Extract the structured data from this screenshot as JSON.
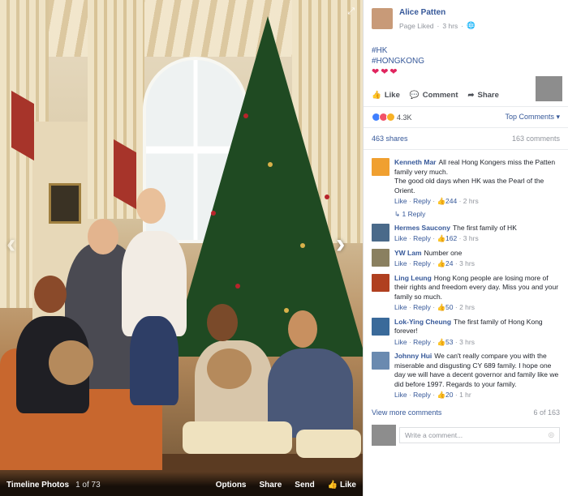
{
  "photo_viewer": {
    "album_label": "Timeline Photos",
    "photo_counter": "1 of 73",
    "actions": {
      "options": "Options",
      "share": "Share",
      "send": "Send",
      "like": "Like"
    }
  },
  "post": {
    "author": "Alice Patten",
    "meta_status": "Page Liked",
    "meta_time": "3 hrs",
    "hashtags": [
      "#HK",
      "#HONGKONG"
    ],
    "hearts": "❤❤❤",
    "actions": {
      "like": "Like",
      "comment": "Comment",
      "share": "Share"
    },
    "reaction_count": "4.3K",
    "top_comments": "Top Comments ▾",
    "shares": "463 shares",
    "comment_count": "163 comments"
  },
  "comments": [
    {
      "name": "Kenneth Mar",
      "text": "All real Hong Kongers miss the Patten family very much.\nThe good old days when HK was the Pearl of the Orient.",
      "likes": "244",
      "time": "2 hrs",
      "avatar_color": "#f0a030",
      "reply": "1 Reply"
    },
    {
      "name": "Hermes Saucony",
      "text": "The first family of HK",
      "likes": "162",
      "time": "3 hrs",
      "avatar_color": "#4a6a8a"
    },
    {
      "name": "YW Lam",
      "text": "Number one",
      "likes": "24",
      "time": "3 hrs",
      "avatar_color": "#8a8060"
    },
    {
      "name": "Ling Leung",
      "text": "Hong Kong people are losing more of their rights and freedom every day. Miss you and your family so much.",
      "likes": "50",
      "time": "2 hrs",
      "avatar_color": "#b04020"
    },
    {
      "name": "Lok-Ying Cheung",
      "text": "The first family of Hong Kong forever!",
      "likes": "53",
      "time": "3 hrs",
      "avatar_color": "#3a6a9a"
    },
    {
      "name": "Johnny Hui",
      "text": "We can't really compare you with the miserable and disgusting CY 689 family. I hope one day we will have a decent governor and family like we did before 1997. Regards to your family.",
      "likes": "20",
      "time": "1 hr",
      "avatar_color": "#6a8ab0"
    }
  ],
  "comment_labels": {
    "like": "Like",
    "reply": "Reply"
  },
  "view_more": "View more comments",
  "pagination": "6 of 163",
  "write_placeholder": "Write a comment..."
}
